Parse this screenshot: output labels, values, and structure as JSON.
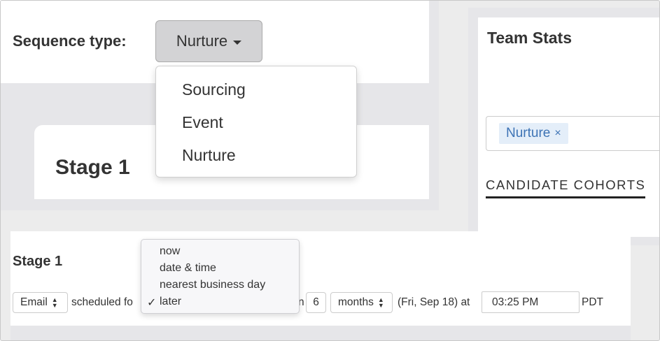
{
  "sequence": {
    "label": "Sequence type:",
    "selected": "Nurture",
    "options": [
      "Sourcing",
      "Event",
      "Nurture"
    ]
  },
  "stage_card": {
    "title": "Stage 1"
  },
  "team_stats": {
    "title": "Team Stats",
    "tag": "Nurture",
    "tag_remove": "×",
    "tab": "CANDIDATE COHORTS"
  },
  "stage_row": {
    "title": "Stage 1",
    "channel": "Email",
    "scheduled_text": "scheduled fo",
    "hidden_text": "n",
    "amount": "6",
    "unit": "months",
    "date_text": "(Fri, Sep 18) at",
    "time": "03:25 PM",
    "tz": "PDT"
  },
  "when_menu": {
    "options": [
      "now",
      "date & time",
      "nearest business day",
      "later"
    ],
    "checked": "later",
    "check_glyph": "✓"
  },
  "icons": {
    "caret": "caret-down-icon",
    "updown": "updown-arrows-icon",
    "check": "checkmark-icon"
  }
}
